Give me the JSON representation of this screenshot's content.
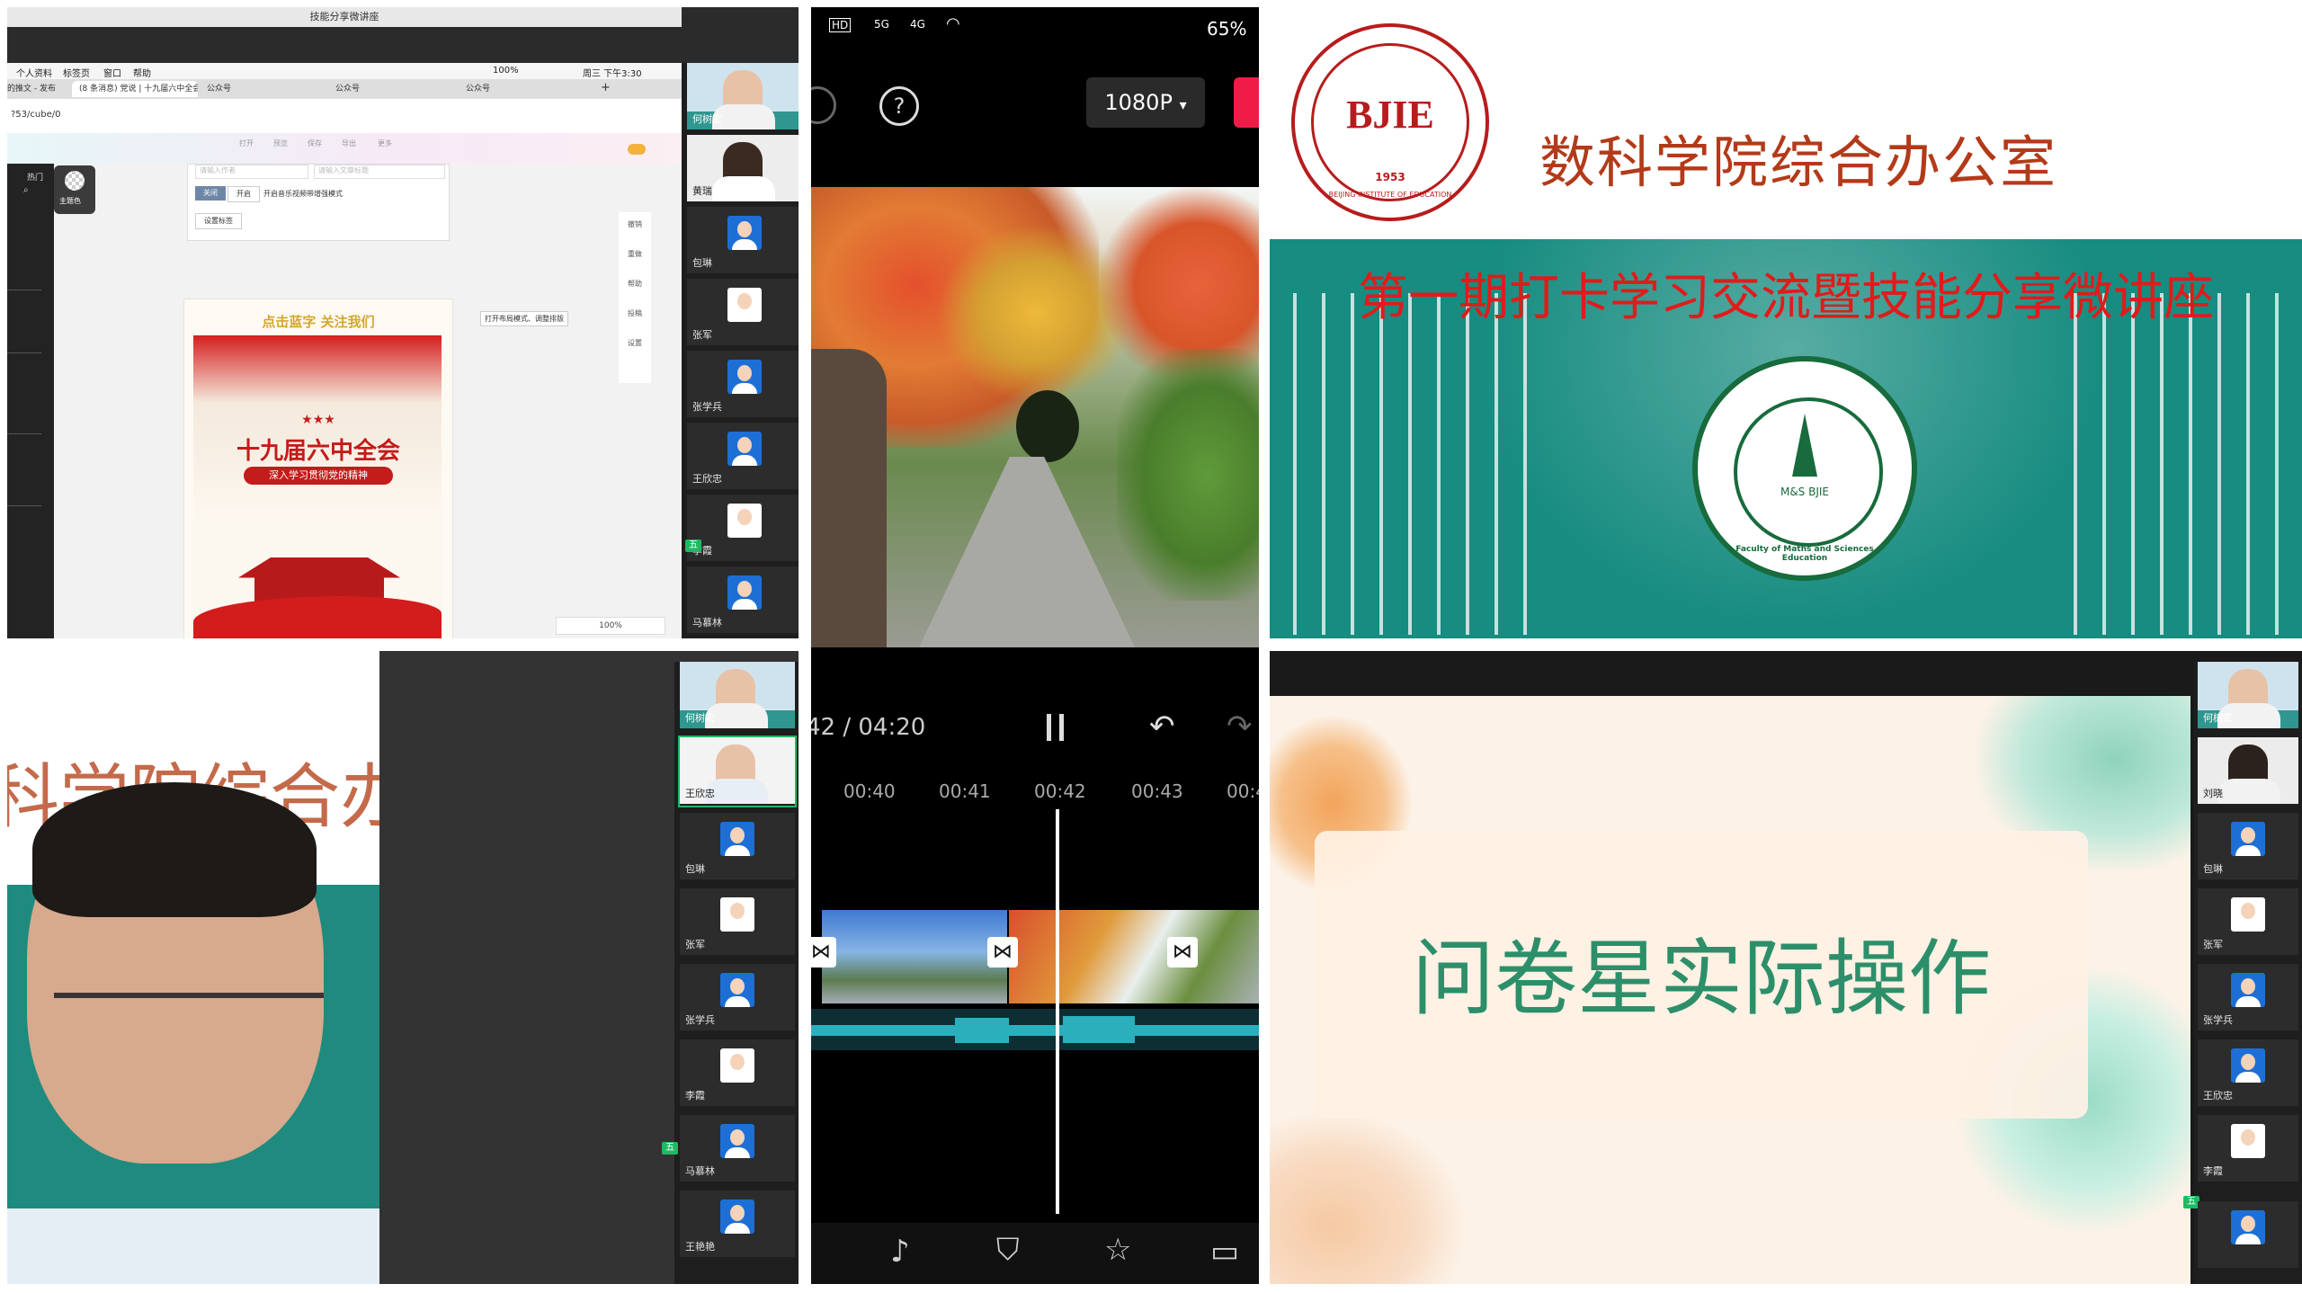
{
  "tl": {
    "window_title": "技能分享微讲座",
    "menu_items": [
      "个人资料",
      "标签页",
      "窗口",
      "帮助"
    ],
    "menu_status": "100%",
    "menu_clock": "周三 下午3:30",
    "tabs": [
      "的推文 - 发布",
      "(8 条消息) 党说 | 十九届六中全会",
      "公众号",
      "公众号",
      "公众号"
    ],
    "url": "?53/cube/0",
    "toolbar_labels": [
      "打开",
      "预览",
      "保存",
      "导出",
      "更多"
    ],
    "left_panel_items": [
      "热门",
      "主题色"
    ],
    "settings": {
      "tab_off": "关闭",
      "tab_on": "开启",
      "desc": "开启音乐视频带增强模式",
      "button": "设置标签",
      "placeholder": "请输入作者",
      "placeholder2": "请输入文章标题"
    },
    "right_tools": [
      "撤销",
      "重做",
      "帮助",
      "投稿",
      "设置"
    ],
    "tooltip": "打开布局模式、调整排版",
    "zoom": "100%",
    "poster": {
      "top": "点击蓝字 关注我们",
      "stars": "★★★",
      "title": "十九届六中全会",
      "subtitle": "深入学习贯彻党的精神"
    },
    "participants": [
      "何树宏",
      "黄瑞",
      "包琳",
      "张军",
      "张学兵",
      "王欣忠",
      "李霞",
      "马慕林"
    ],
    "floating_bar": "五"
  },
  "tm": {
    "status_icons": [
      "HD",
      "5G",
      "4G"
    ],
    "battery": "65%",
    "help_icon": "?",
    "resolution": "1080P",
    "time_readout": "42 / 04:20",
    "ruler": [
      "00:40",
      "00:41",
      "00:42",
      "00:43",
      "00:4"
    ],
    "bottom_icons": [
      "music-icon",
      "sticker-icon",
      "effect-icon",
      "folder-icon"
    ]
  },
  "tr": {
    "logo_text": "BJIE",
    "logo_year": "1953",
    "logo_ring": "BEIJING INSTITUTE OF EDUCATION",
    "office_title": "数科学院综合办公室",
    "banner_title": "第一期打卡学习交流暨技能分享微讲座",
    "seal_center": "M&S BJIE",
    "seal_ring": "Faculty of Maths and Sciences Education"
  },
  "bl": {
    "bg_title": "科学院综合办公",
    "participants": [
      "何树宏",
      "王欣忠",
      "包琳",
      "张军",
      "张学兵",
      "李霞",
      "马慕林",
      "王艳艳"
    ],
    "floating_bar": "五"
  },
  "br": {
    "slide_title": "问卷星实际操作",
    "participants": [
      "何树宏",
      "刘晓",
      "包琳",
      "张军",
      "张学兵",
      "王欣忠",
      "李霞"
    ],
    "floating_bar": "五"
  },
  "colors": {
    "accent_teal": "#138a7e",
    "brand_red": "#b71c1c",
    "slide_green": "#2c8f6a",
    "zoom_green": "#1fb964"
  }
}
